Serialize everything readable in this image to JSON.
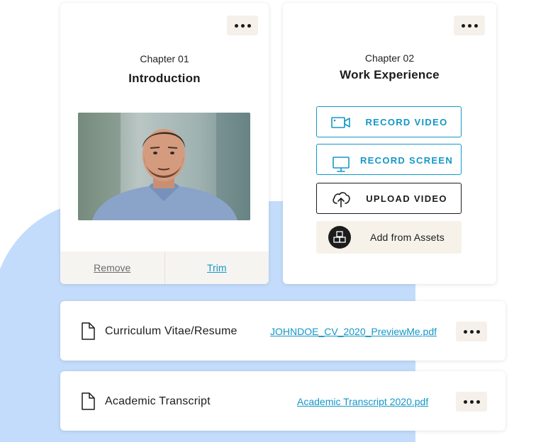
{
  "chapters": [
    {
      "label": "Chapter 01",
      "title": "Introduction",
      "footer": {
        "remove": "Remove",
        "trim": "Trim"
      }
    },
    {
      "label": "Chapter 02",
      "title": "Work Experience",
      "actions": {
        "record_video": "RECORD VIDEO",
        "record_screen": "RECORD SCREEN",
        "upload_video": "UPLOAD VIDEO",
        "add_assets": "Add from Assets"
      }
    }
  ],
  "documents": [
    {
      "title": "Curriculum Vitae/Resume",
      "file": "JOHNDOE_CV_2020_PreviewMe.pdf",
      "icon": "document-icon"
    },
    {
      "title": "Academic Transcript",
      "file": "Academic Transcript 2020.pdf",
      "icon": "document-icon"
    }
  ],
  "colors": {
    "accent": "#1497c7",
    "blob": "#c3dcfb",
    "menu_bg": "#f5f1ea",
    "dark": "#1c1c1c"
  }
}
